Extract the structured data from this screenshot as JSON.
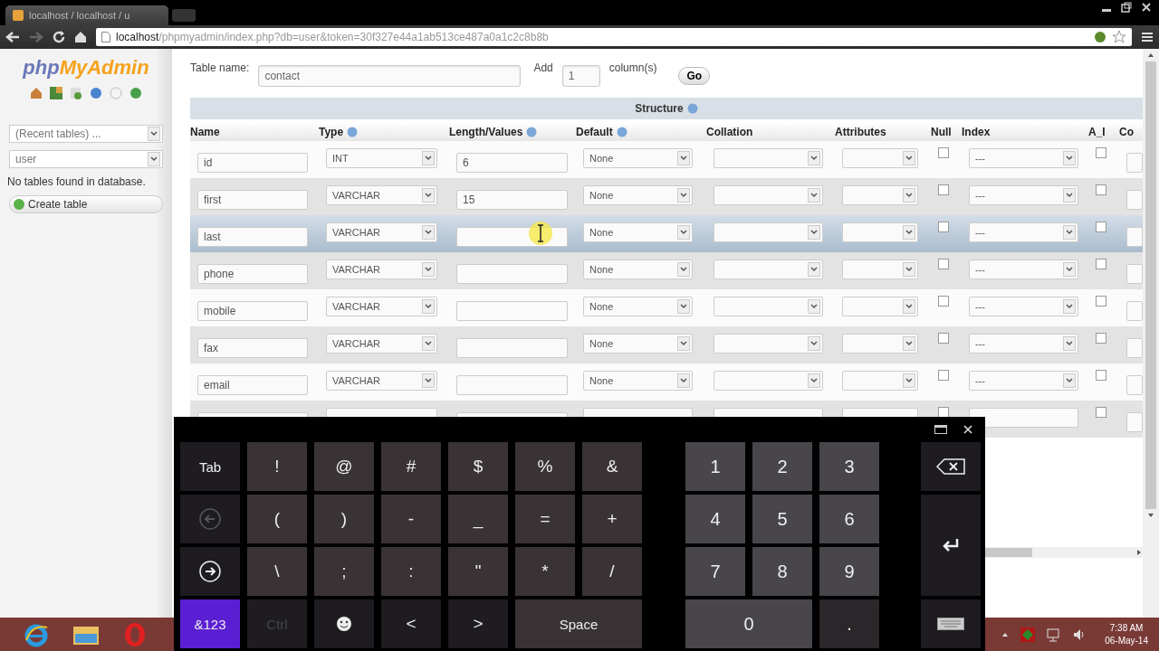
{
  "browser": {
    "tab_title": "localhost / localhost / u",
    "address_host": "localhost",
    "address_path": "/phpmyadmin/index.php?db=user&token=30f327e44a1ab513ce487a0a1c2c8b8b"
  },
  "sidebar": {
    "logo_prefix": "php",
    "logo_main": "MyAdmin",
    "recent_tables": "(Recent tables) ...",
    "database": "user",
    "message": "No tables found in database.",
    "create_button": "Create table"
  },
  "form": {
    "table_name_label": "Table name:",
    "table_name": "contact",
    "add_label": "Add",
    "add_count": "1",
    "columns_label": "column(s)",
    "go_button": "Go"
  },
  "structure": {
    "title": "Structure",
    "columns": [
      {
        "label": "Name",
        "help": false
      },
      {
        "label": "Type",
        "help": true
      },
      {
        "label": "Length/Values",
        "help": true
      },
      {
        "label": "Default",
        "help": true
      },
      {
        "label": "Collation",
        "help": false
      },
      {
        "label": "Attributes",
        "help": false
      },
      {
        "label": "Null",
        "help": false
      },
      {
        "label": "Index",
        "help": false
      },
      {
        "label": "A_I",
        "help": false
      },
      {
        "label": "Co",
        "help": false
      }
    ]
  },
  "rows": [
    {
      "name": "id",
      "type": "INT",
      "length": "6",
      "default": "None",
      "index": "---",
      "null_checked": false,
      "ai_checked": false,
      "selected": false
    },
    {
      "name": "first",
      "type": "VARCHAR",
      "length": "15",
      "default": "None",
      "index": "---",
      "null_checked": false,
      "ai_checked": false,
      "selected": false
    },
    {
      "name": "last",
      "type": "VARCHAR",
      "default": "None",
      "index": "---",
      "null_checked": false,
      "ai_checked": false,
      "selected": true
    },
    {
      "name": "phone",
      "type": "VARCHAR",
      "default": "None",
      "index": "---",
      "null_checked": false,
      "ai_checked": false,
      "selected": false
    },
    {
      "name": "mobile",
      "type": "VARCHAR",
      "default": "None",
      "index": "---",
      "null_checked": false,
      "ai_checked": false,
      "selected": false
    },
    {
      "name": "fax",
      "type": "VARCHAR",
      "default": "None",
      "index": "---",
      "null_checked": false,
      "ai_checked": false,
      "selected": false
    },
    {
      "name": "email",
      "type": "VARCHAR",
      "default": "None",
      "index": "---",
      "null_checked": false,
      "ai_checked": false,
      "selected": false
    },
    {
      "null_checked": false,
      "ai_checked": false,
      "selected": false
    }
  ],
  "keyboard": {
    "left_keys": [
      {
        "kind": "action",
        "label": "Tab",
        "selected": false,
        "disabled": false
      },
      {
        "kind": "char",
        "label": "!",
        "selected": false,
        "disabled": false
      },
      {
        "kind": "char",
        "label": "@",
        "selected": false,
        "disabled": false
      },
      {
        "kind": "char",
        "label": "#",
        "selected": false,
        "disabled": false
      },
      {
        "kind": "char",
        "label": "$",
        "selected": false,
        "disabled": false
      },
      {
        "kind": "char",
        "label": "%",
        "selected": false,
        "disabled": false
      },
      {
        "kind": "char",
        "label": "&",
        "selected": false,
        "disabled": false
      },
      {
        "kind": "back",
        "selected": false,
        "disabled": true
      },
      {
        "kind": "char",
        "label": "(",
        "selected": false,
        "disabled": false
      },
      {
        "kind": "char",
        "label": ")",
        "selected": false,
        "disabled": false
      },
      {
        "kind": "char",
        "label": "-",
        "selected": false,
        "disabled": false
      },
      {
        "kind": "char",
        "label": "_",
        "selected": false,
        "disabled": false
      },
      {
        "kind": "char",
        "label": "=",
        "selected": false,
        "disabled": false
      },
      {
        "kind": "char",
        "label": "+",
        "selected": false,
        "disabled": false
      },
      {
        "kind": "forward",
        "selected": false,
        "disabled": false
      },
      {
        "kind": "char",
        "label": "\\",
        "selected": false,
        "disabled": false
      },
      {
        "kind": "char",
        "label": ";",
        "selected": false,
        "disabled": false
      },
      {
        "kind": "char",
        "label": ":",
        "selected": false,
        "disabled": false
      },
      {
        "kind": "char",
        "label": "\"",
        "selected": false,
        "disabled": false
      },
      {
        "kind": "char",
        "label": "*",
        "selected": false,
        "disabled": false
      },
      {
        "kind": "char",
        "label": "/",
        "selected": false,
        "disabled": false
      },
      {
        "kind": "action",
        "label": "&123",
        "selected": true,
        "disabled": false
      },
      {
        "kind": "action",
        "label": "Ctrl",
        "selected": false,
        "disabled": true
      },
      {
        "kind": "emoji",
        "selected": false,
        "disabled": false
      },
      {
        "kind": "action",
        "label": "<",
        "selected": false,
        "disabled": false
      },
      {
        "kind": "action",
        "label": ">",
        "selected": false,
        "disabled": false
      },
      {
        "kind": "wide",
        "label": "Space",
        "selected": false,
        "disabled": false
      }
    ],
    "number_keys": [
      {
        "kind": "char",
        "label": "1"
      },
      {
        "kind": "char",
        "label": "2"
      },
      {
        "kind": "char",
        "label": "3"
      },
      {
        "kind": "char",
        "label": "4"
      },
      {
        "kind": "char",
        "label": "5"
      },
      {
        "kind": "char",
        "label": "6"
      },
      {
        "kind": "char",
        "label": "7"
      },
      {
        "kind": "char",
        "label": "8"
      },
      {
        "kind": "char",
        "label": "9"
      },
      {
        "kind": "wide",
        "label": "0"
      },
      {
        "kind": "dark",
        "label": "."
      }
    ],
    "side_keys": [
      {
        "kind": "backspace"
      },
      {
        "kind": "enter"
      },
      {
        "kind": "hide"
      }
    ]
  },
  "taskbar": {
    "time": "7:38 AM",
    "date": "06-May-14"
  }
}
